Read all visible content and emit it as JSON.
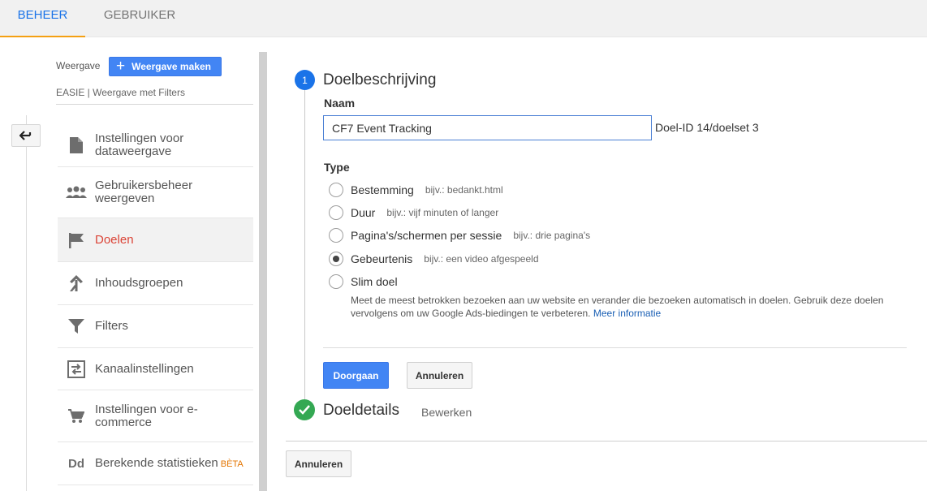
{
  "tabs": {
    "admin": "BEHEER",
    "user": "GEBRUIKER"
  },
  "sidebar": {
    "view_label": "Weergave",
    "create_view": "Weergave maken",
    "view_name": "EASIE | Weergave met Filters",
    "items": [
      {
        "label": "Instellingen voor dataweergave",
        "icon": "document-icon"
      },
      {
        "label": "Gebruikersbeheer weergeven",
        "icon": "people-icon"
      },
      {
        "label": "Doelen",
        "icon": "flag-icon",
        "active": true
      },
      {
        "label": "Inhoudsgroepen",
        "icon": "content-grouping-icon"
      },
      {
        "label": "Filters",
        "icon": "filter-icon"
      },
      {
        "label": "Kanaalinstellingen",
        "icon": "channel-settings-icon"
      },
      {
        "label": "Instellingen voor e-commerce",
        "icon": "cart-icon"
      },
      {
        "label": "Berekende statistieken",
        "badge": "BÈTA",
        "icon_text": "Dd"
      }
    ]
  },
  "goal": {
    "step_number": "1",
    "description_title": "Doelbeschrijving",
    "name_label": "Naam",
    "name_value": "CF7 Event Tracking",
    "goal_id": "Doel-ID 14/doelset 3",
    "type_label": "Type",
    "types": [
      {
        "label": "Bestemming",
        "hint": "bijv.: bedankt.html",
        "checked": false
      },
      {
        "label": "Duur",
        "hint": "bijv.: vijf minuten of langer",
        "checked": false
      },
      {
        "label": "Pagina's/schermen per sessie",
        "hint": "bijv.: drie pagina's",
        "checked": false
      },
      {
        "label": "Gebeurtenis",
        "hint": "bijv.: een video afgespeeld",
        "checked": true
      },
      {
        "label": "Slim doel",
        "hint": "",
        "checked": false
      }
    ],
    "smart_desc": "Meet de meest betrokken bezoeken aan uw website en verander die bezoeken automatisch in doelen. Gebruik deze doelen vervolgens om uw Google Ads-biedingen te verbeteren.",
    "more_info": "Meer informatie",
    "continue_btn": "Doorgaan",
    "cancel_btn": "Annuleren",
    "details_title": "Doeldetails",
    "edit_link": "Bewerken",
    "bottom_cancel": "Annuleren"
  },
  "colors": {
    "accent": "#1a73e8",
    "tab_underline": "#f4a012",
    "active_nav": "#db4437",
    "success": "#34a853",
    "primary_button": "#4285f4"
  }
}
